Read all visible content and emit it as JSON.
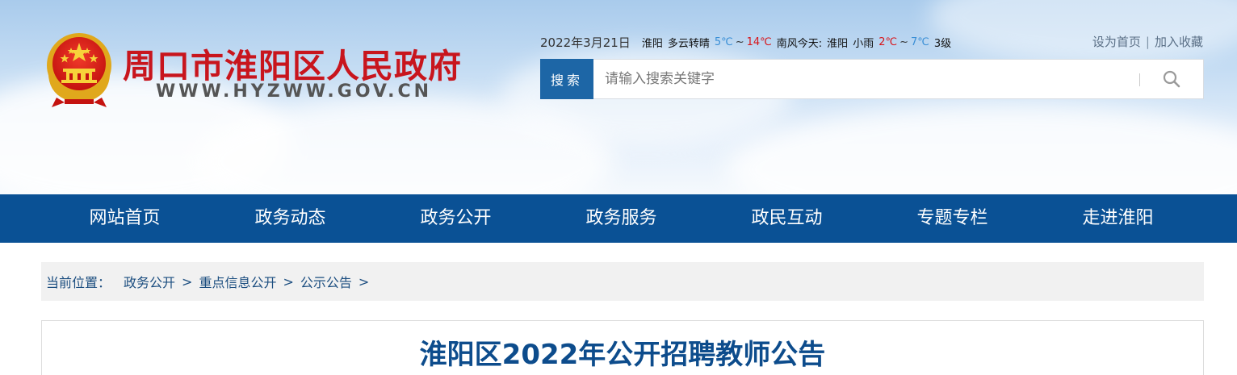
{
  "header": {
    "site_title": "周口市淮阳区人民政府",
    "site_url": "WWW.HYZWW.GOV.CN",
    "date": "2022年3月21日",
    "weather_today": {
      "city": "淮阳",
      "desc": "多云转晴",
      "low": "5℃",
      "high": "14℃",
      "wind_label": "南风今天:"
    },
    "weather_next": {
      "city": "淮阳",
      "desc": "小雨",
      "low": "2℃",
      "high": "7℃",
      "level": "3级"
    },
    "tilde": "~",
    "links": {
      "set_home": "设为首页",
      "separator": "|",
      "add_favorite": "加入收藏"
    }
  },
  "search": {
    "label": "搜索",
    "placeholder": "请输入搜索关键字"
  },
  "nav": {
    "items": [
      "网站首页",
      "政务动态",
      "政务公开",
      "政务服务",
      "政民互动",
      "专题专栏",
      "走进淮阳"
    ]
  },
  "breadcrumb": {
    "prefix": "当前位置：",
    "items": [
      "政务公开",
      "重点信息公开",
      "公示公告"
    ],
    "separator": ">"
  },
  "article": {
    "title": "淮阳区2022年公开招聘教师公告"
  },
  "colors": {
    "nav_bg": "#0a5195",
    "title_red": "#c8151d",
    "search_label_bg": "#1d66a6",
    "article_title": "#0d4c8c"
  }
}
